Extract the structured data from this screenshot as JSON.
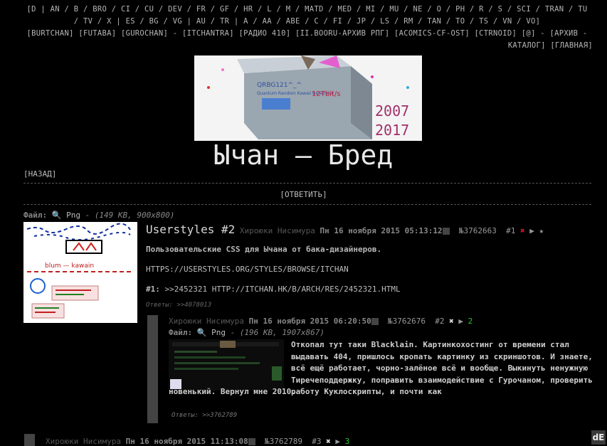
{
  "nav": {
    "line1": "[D | AN / B / BRO / CI / CU / DEV / FR / GF / HR / L / M / MATD / MED / MI / MU / NE / O / PH / R / S / SCI / TRAN / TU",
    "line2": "/ TV / X | ES / BG / VG | AU / TR | A / AA / ABE / C / FI / JP / LS / RM / TAN / TO / TS / VN / VO]",
    "line3": "[BURTCHAN] [FUTABA] [GUROCHAN] - [ITCHANTRA] [РАДИО 410] [II.BOORU-АРХИВ РПГ] [ACOMICS-CF-OST] [CTRNOID] [@] - [АРХИВ -",
    "line4": "КАТАЛОГ] [ГЛАВНАЯ]"
  },
  "banner": {
    "chip_label": "QRBG121^_^",
    "chip_sub": "Quantum Random Kawaii Generator",
    "speed": "12Tbit/s",
    "year1": "2007",
    "year2": "2017"
  },
  "board": {
    "title": "Ычан — Бред"
  },
  "back_link": "[НАЗАД]",
  "reply_link": "[ОТВЕТИТЬ]",
  "op": {
    "file_label": "Файл:",
    "file_name": "🔍 Png",
    "file_meta": "(149 KB, 900x800)",
    "subject": "Userstyles #2",
    "poster": "Хироюки Нисимура",
    "date": "Пн 16 ноября 2015 05:13:12",
    "number": "№3762663",
    "index": "#1",
    "text1": "Пользовательские CSS для Ычана от бака-дизайнеров.",
    "text2": "HTTPS://USERSTYLES.ORG/STYLES/BROWSE/ITCHAN",
    "text3_prefix": "#1:",
    "text3": ">>2452321 HTTP://ITCHAN.HK/B/ARCH/RES/2452321.HTML",
    "replies": "Ответы: >>4078013",
    "thumb_text": "blum — kawain"
  },
  "reply1": {
    "poster": "Хироюки Нисимура",
    "date": "Пн 16 ноября 2015 06:20:50",
    "number": "№3762676",
    "index": "#2",
    "count": "2",
    "file_label": "Файл:",
    "file_name": "🔍 Png",
    "file_meta": "(196 KB, 1907x867)",
    "text": "Откопал тут таки Blacklain. Картинкохостинг от времени стал выдавать 404, пришлось кропать картинку из скриншотов. И знаете, всё ещё работает, чорно-залёное всё и вообще. Выкинуть ненужную Тиречеподдержку, поправить взаимодействие с Гурочаном, проверить работу Куклоскрипты, и почти как",
    "text_cont": "новенький. Вернул мне 2010.",
    "replies": "Ответы: >>3762789"
  },
  "reply2": {
    "poster": "Хироюки Нисимура",
    "date": "Пн 16 ноября 2015 11:13:08",
    "number": "№3762789",
    "index": "#3",
    "count": "3"
  },
  "corner_logo": "dE",
  "icons": [
    "close-icon",
    "reply-arrow-icon",
    "star-icon",
    "magnifier-icon"
  ]
}
